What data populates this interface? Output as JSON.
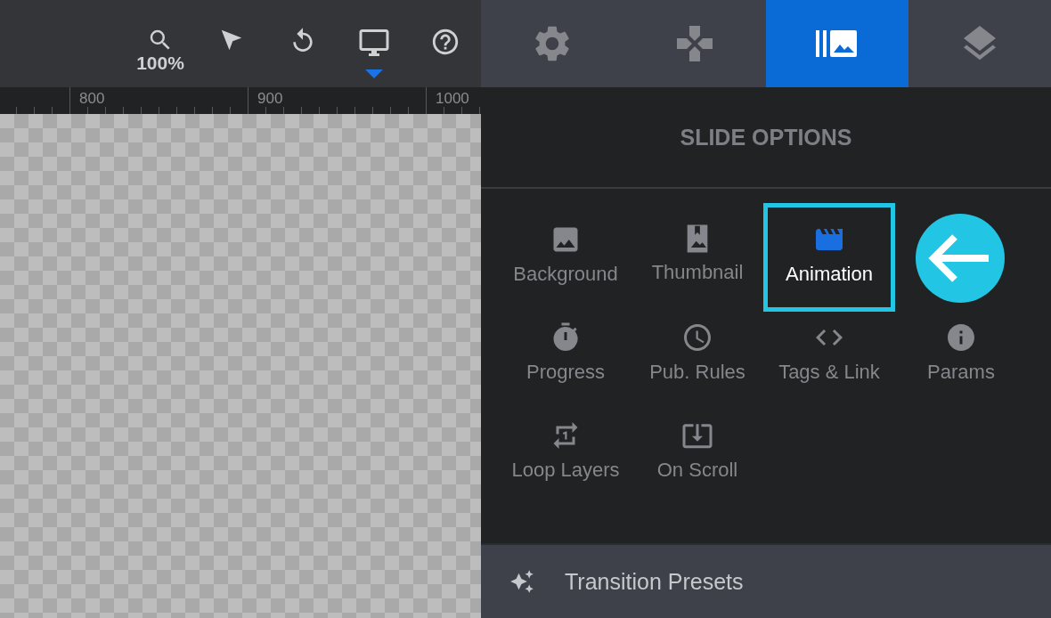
{
  "toolbar": {
    "tools": [
      {
        "kind": "zoom",
        "label": "100%",
        "selected": false
      },
      {
        "kind": "pointer",
        "selected": false
      },
      {
        "kind": "undo",
        "selected": false
      },
      {
        "kind": "device",
        "selected": true
      },
      {
        "kind": "help",
        "selected": false
      }
    ]
  },
  "ruler": {
    "labels": [
      "800",
      "900",
      "1000"
    ]
  },
  "tabs": [
    {
      "selected": false
    },
    {
      "selected": false
    },
    {
      "selected": true
    },
    {
      "selected": false
    }
  ],
  "panel": {
    "title": "SLIDE OPTIONS",
    "options": [
      {
        "label": "Background",
        "selected": false
      },
      {
        "label": "Thumbnail",
        "selected": false
      },
      {
        "label": "Animation",
        "selected": true
      },
      {
        "label": "Progress",
        "selected": false
      },
      {
        "label": "Pub. Rules",
        "selected": false
      },
      {
        "label": "Tags & Link",
        "selected": false
      },
      {
        "label": "Params",
        "selected": false
      },
      {
        "label": "Loop Layers",
        "selected": false
      },
      {
        "label": "On Scroll",
        "selected": false
      }
    ],
    "callout": {
      "kind": "arrow"
    }
  },
  "footer": {
    "label": "Transition Presets"
  }
}
